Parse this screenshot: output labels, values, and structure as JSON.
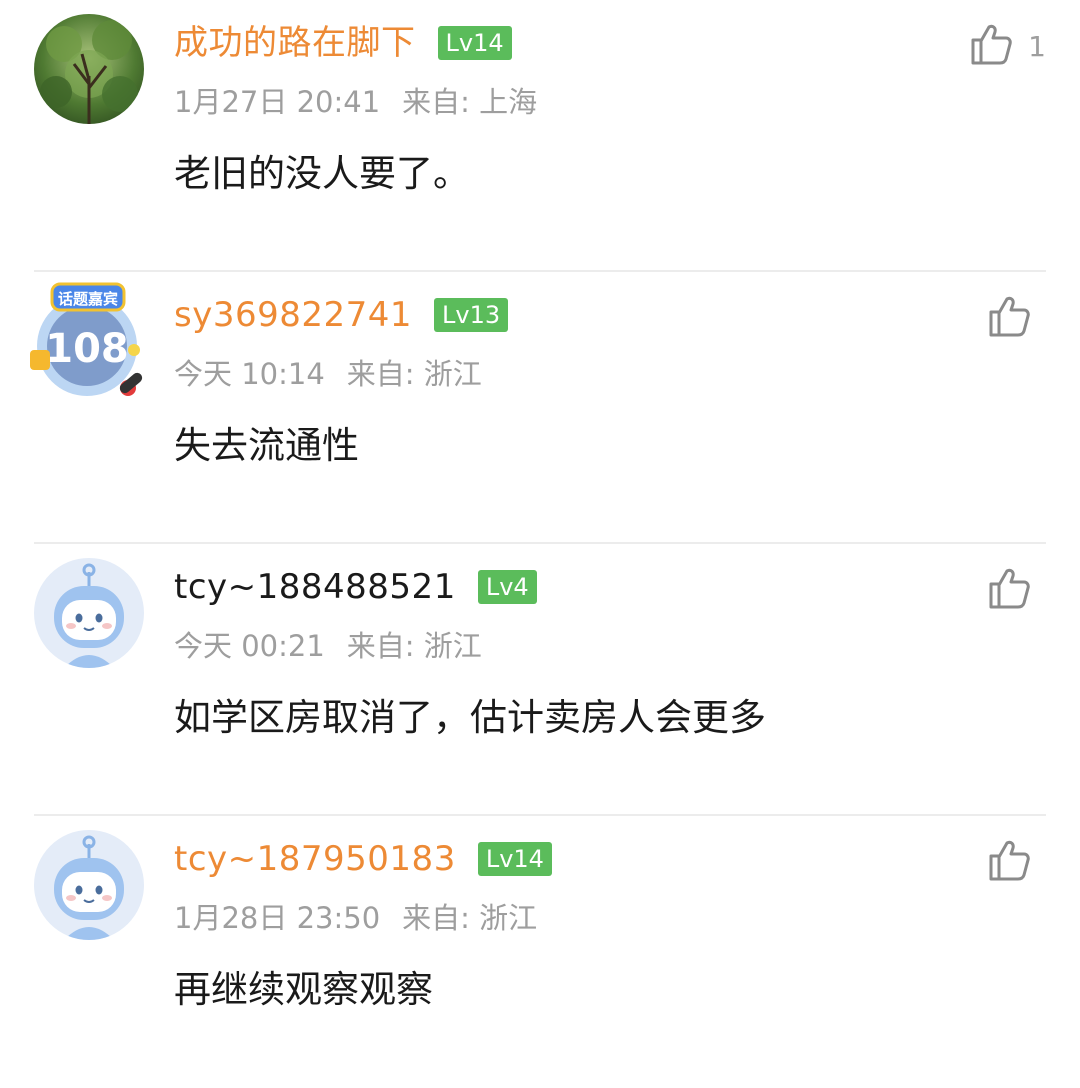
{
  "comments": [
    {
      "username": "成功的路在脚下",
      "level": "Lv14",
      "date": "1月27日 20:41",
      "location": "来自: 上海",
      "text": "老旧的没人要了。",
      "likes": "1",
      "avatar": "tree-photo"
    },
    {
      "username": "sy369822741",
      "level": "Lv13",
      "date": "今天 10:14",
      "location": "来自: 浙江",
      "text": "失去流通性",
      "likes": "",
      "avatar": "topic-guest-badge",
      "badge_text": "话题嘉宾",
      "badge_number": "108"
    },
    {
      "username": "tcy~188488521",
      "level": "Lv4",
      "date": "今天 00:21",
      "location": "来自: 浙江",
      "text": "如学区房取消了，估计卖房人会更多",
      "likes": "",
      "avatar": "default-cartoon"
    },
    {
      "username": "tcy~187950183",
      "level": "Lv14",
      "date": "1月28日 23:50",
      "location": "来自: 浙江",
      "text": "再继续观察观察",
      "likes": "",
      "avatar": "default-cartoon"
    }
  ],
  "colors": {
    "username": "#ed8a35",
    "username_plain": "#1a1a1a",
    "level_badge": "#5bbc5b",
    "meta": "#9e9e9e"
  }
}
